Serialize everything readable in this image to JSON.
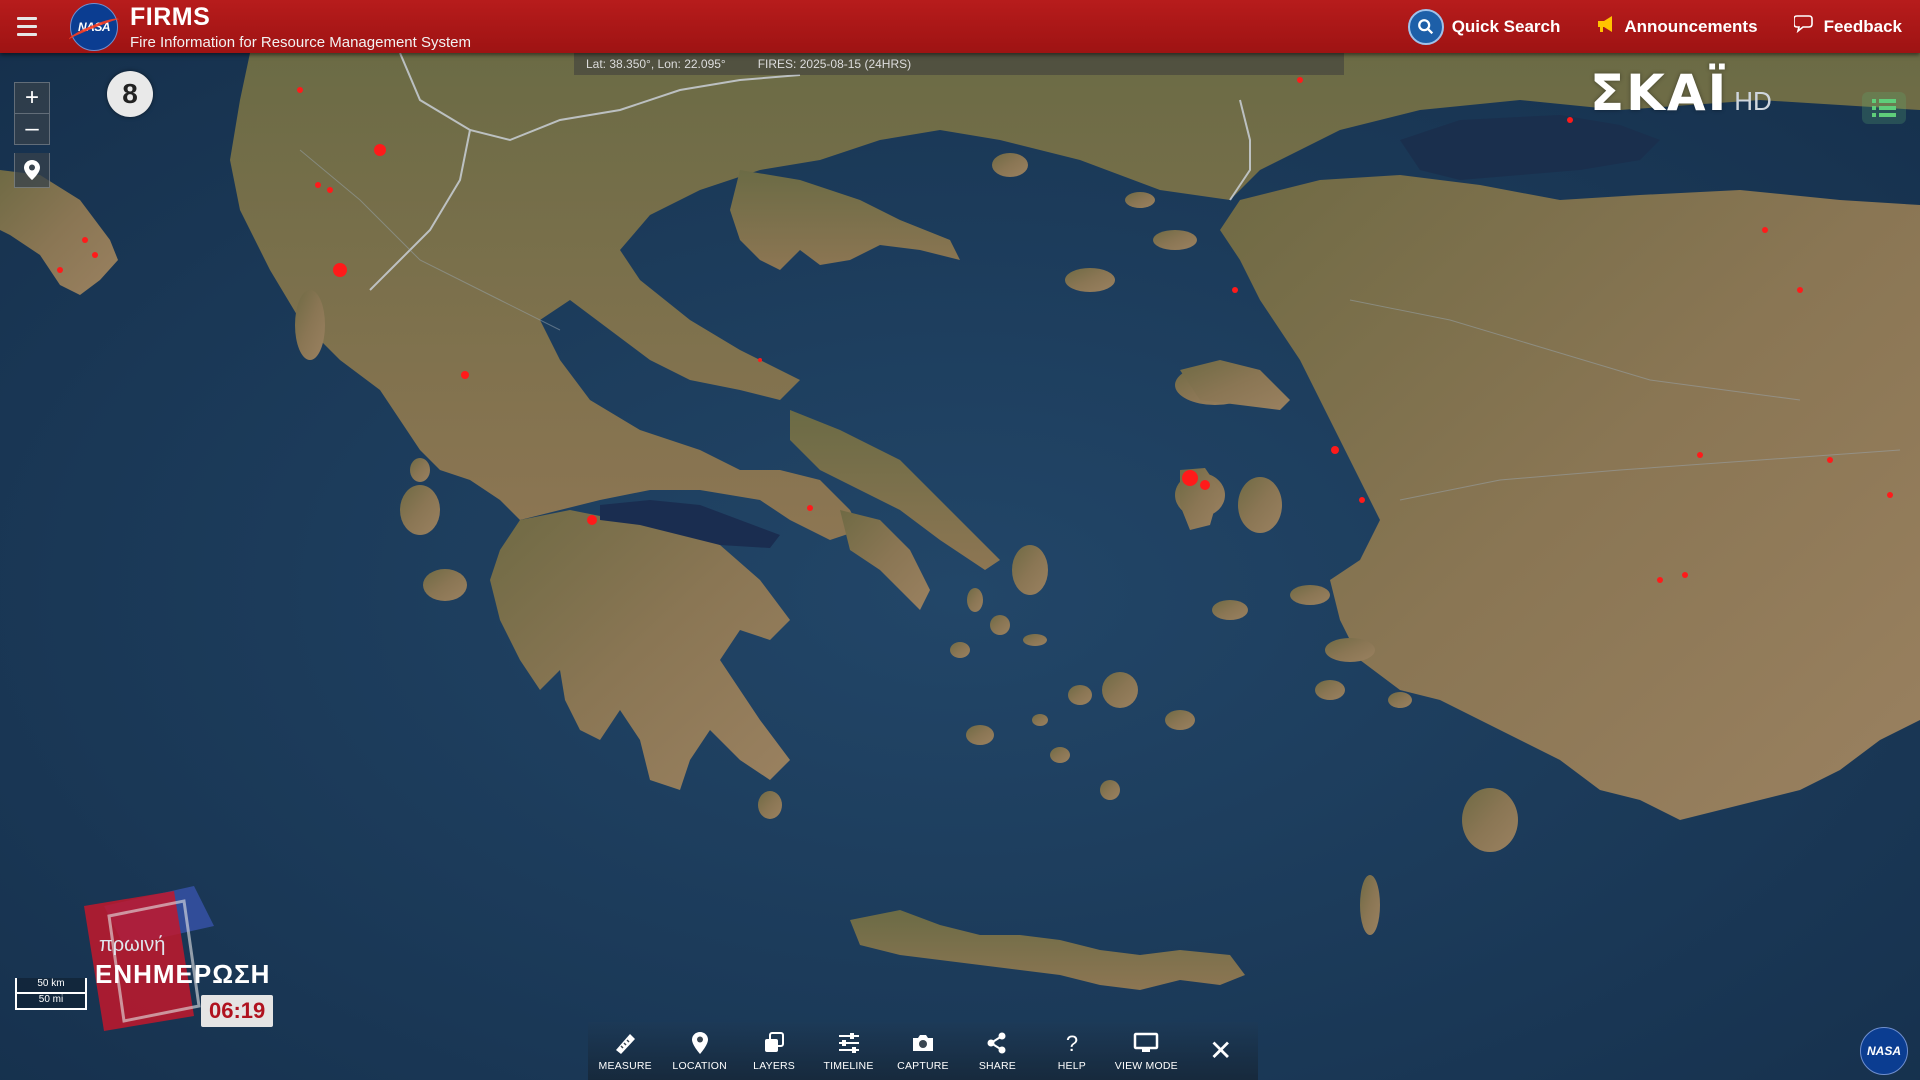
{
  "header": {
    "brand_name": "FIRMS",
    "brand_subtitle": "Fire Information for Resource Management System",
    "nasa_logo_text": "NASA",
    "quick_search": "Quick Search",
    "announcements": "Announcements",
    "feedback": "Feedback"
  },
  "coord_bar": {
    "latlon": "Lat: 38.350°, Lon: 22.095°",
    "fires": "FIRES: 2025-08-15 (24HRS)"
  },
  "map": {
    "zoom_level": "8",
    "zoom_in": "+",
    "zoom_out": "–"
  },
  "scale": {
    "km": "50 km",
    "mi": "50 mi"
  },
  "toolbar": [
    {
      "label": "MEASURE",
      "icon": "ruler-icon"
    },
    {
      "label": "LOCATION",
      "icon": "map-pin-icon"
    },
    {
      "label": "LAYERS",
      "icon": "layers-icon"
    },
    {
      "label": "TIMELINE",
      "icon": "sliders-icon"
    },
    {
      "label": "CAPTURE",
      "icon": "camera-icon"
    },
    {
      "label": "SHARE",
      "icon": "share-icon"
    },
    {
      "label": "HELP",
      "icon": "question-icon"
    },
    {
      "label": "VIEW MODE",
      "icon": "monitor-icon"
    }
  ],
  "close_label": "✕",
  "channel_logo": {
    "name": "ΣΚΑΪ",
    "suffix": "HD"
  },
  "tv_overlay": {
    "show_line1": "πρωινή",
    "show_line2": "ΕΝΗΜΕΡΩΣΗ",
    "clock": "06:19"
  },
  "colors": {
    "header_red": "#b71c1c",
    "fire_red": "#ff1a1a",
    "sea": "#1d3c5c",
    "land": "#8a7654"
  }
}
